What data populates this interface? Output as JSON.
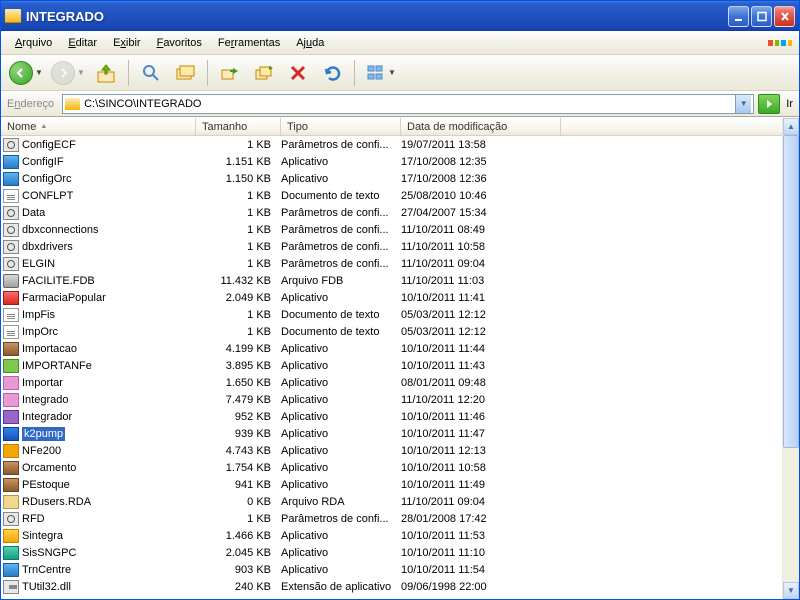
{
  "window": {
    "title": "INTEGRADO"
  },
  "menu": {
    "arquivo": "Arquivo",
    "editar": "Editar",
    "exibir": "Exibir",
    "favoritos": "Favoritos",
    "ferramentas": "Ferramentas",
    "ajuda": "Ajuda"
  },
  "addressbar": {
    "label": "Endereço",
    "path": "C:\\SINCO\\INTEGRADO",
    "go": "Ir"
  },
  "columns": {
    "nome": "Nome",
    "tamanho": "Tamanho",
    "tipo": "Tipo",
    "modificacao": "Data de modificação"
  },
  "files": [
    {
      "name": "ConfigECF",
      "size": "1 KB",
      "type": "Parâmetros de confi...",
      "mod": "19/07/2011 13:58",
      "ico": "gear"
    },
    {
      "name": "ConfigIF",
      "size": "1.151 KB",
      "type": "Aplicativo",
      "mod": "17/10/2008 12:35",
      "ico": "exe"
    },
    {
      "name": "ConfigOrc",
      "size": "1.150 KB",
      "type": "Aplicativo",
      "mod": "17/10/2008 12:36",
      "ico": "exe"
    },
    {
      "name": "CONFLPT",
      "size": "1 KB",
      "type": "Documento de texto",
      "mod": "25/08/2010 10:46",
      "ico": "txt"
    },
    {
      "name": "Data",
      "size": "1 KB",
      "type": "Parâmetros de confi...",
      "mod": "27/04/2007 15:34",
      "ico": "gear"
    },
    {
      "name": "dbxconnections",
      "size": "1 KB",
      "type": "Parâmetros de confi...",
      "mod": "11/10/2011 08:49",
      "ico": "gear"
    },
    {
      "name": "dbxdrivers",
      "size": "1 KB",
      "type": "Parâmetros de confi...",
      "mod": "11/10/2011 10:58",
      "ico": "gear"
    },
    {
      "name": "ELGIN",
      "size": "1 KB",
      "type": "Parâmetros de confi...",
      "mod": "11/10/2011 09:04",
      "ico": "gear"
    },
    {
      "name": "FACILITE.FDB",
      "size": "11.432 KB",
      "type": "Arquivo FDB",
      "mod": "11/10/2011 11:03",
      "ico": "db"
    },
    {
      "name": "FarmaciaPopular",
      "size": "2.049 KB",
      "type": "Aplicativo",
      "mod": "10/10/2011 11:41",
      "ico": "pharm"
    },
    {
      "name": "ImpFis",
      "size": "1 KB",
      "type": "Documento de texto",
      "mod": "05/03/2011 12:12",
      "ico": "txt"
    },
    {
      "name": "ImpOrc",
      "size": "1 KB",
      "type": "Documento de texto",
      "mod": "05/03/2011 12:12",
      "ico": "txt"
    },
    {
      "name": "Importacao",
      "size": "4.199 KB",
      "type": "Aplicativo",
      "mod": "10/10/2011 11:44",
      "ico": "brown"
    },
    {
      "name": "IMPORTANFe",
      "size": "3.895 KB",
      "type": "Aplicativo",
      "mod": "10/10/2011 11:43",
      "ico": "green"
    },
    {
      "name": "Importar",
      "size": "1.650 KB",
      "type": "Aplicativo",
      "mod": "08/01/2011 09:48",
      "ico": "pink"
    },
    {
      "name": "Integrado",
      "size": "7.479 KB",
      "type": "Aplicativo",
      "mod": "11/10/2011 12:20",
      "ico": "pink"
    },
    {
      "name": "Integrador",
      "size": "952 KB",
      "type": "Aplicativo",
      "mod": "10/10/2011 11:46",
      "ico": "purple"
    },
    {
      "name": "k2pump",
      "size": "939 KB",
      "type": "Aplicativo",
      "mod": "10/10/2011 11:47",
      "ico": "blue2",
      "selected": true
    },
    {
      "name": "NFe200",
      "size": "4.743 KB",
      "type": "Aplicativo",
      "mod": "10/10/2011 12:13",
      "ico": "orange"
    },
    {
      "name": "Orcamento",
      "size": "1.754 KB",
      "type": "Aplicativo",
      "mod": "10/10/2011 10:58",
      "ico": "brown"
    },
    {
      "name": "PEstoque",
      "size": "941 KB",
      "type": "Aplicativo",
      "mod": "10/10/2011 11:49",
      "ico": "brown"
    },
    {
      "name": "RDusers.RDA",
      "size": "0 KB",
      "type": "Arquivo RDA",
      "mod": "11/10/2011 09:04",
      "ico": "rda"
    },
    {
      "name": "RFD",
      "size": "1 KB",
      "type": "Parâmetros de confi...",
      "mod": "28/01/2008 17:42",
      "ico": "gear"
    },
    {
      "name": "Sintegra",
      "size": "1.466 KB",
      "type": "Aplicativo",
      "mod": "10/10/2011 11:53",
      "ico": "yellow"
    },
    {
      "name": "SisSNGPC",
      "size": "2.045 KB",
      "type": "Aplicativo",
      "mod": "10/10/2011 11:10",
      "ico": "teal"
    },
    {
      "name": "TrnCentre",
      "size": "903 KB",
      "type": "Aplicativo",
      "mod": "10/10/2011 11:54",
      "ico": "exe"
    },
    {
      "name": "TUtil32.dll",
      "size": "240 KB",
      "type": "Extensão de aplicativo",
      "mod": "09/06/1998 22:00",
      "ico": "dll"
    }
  ]
}
